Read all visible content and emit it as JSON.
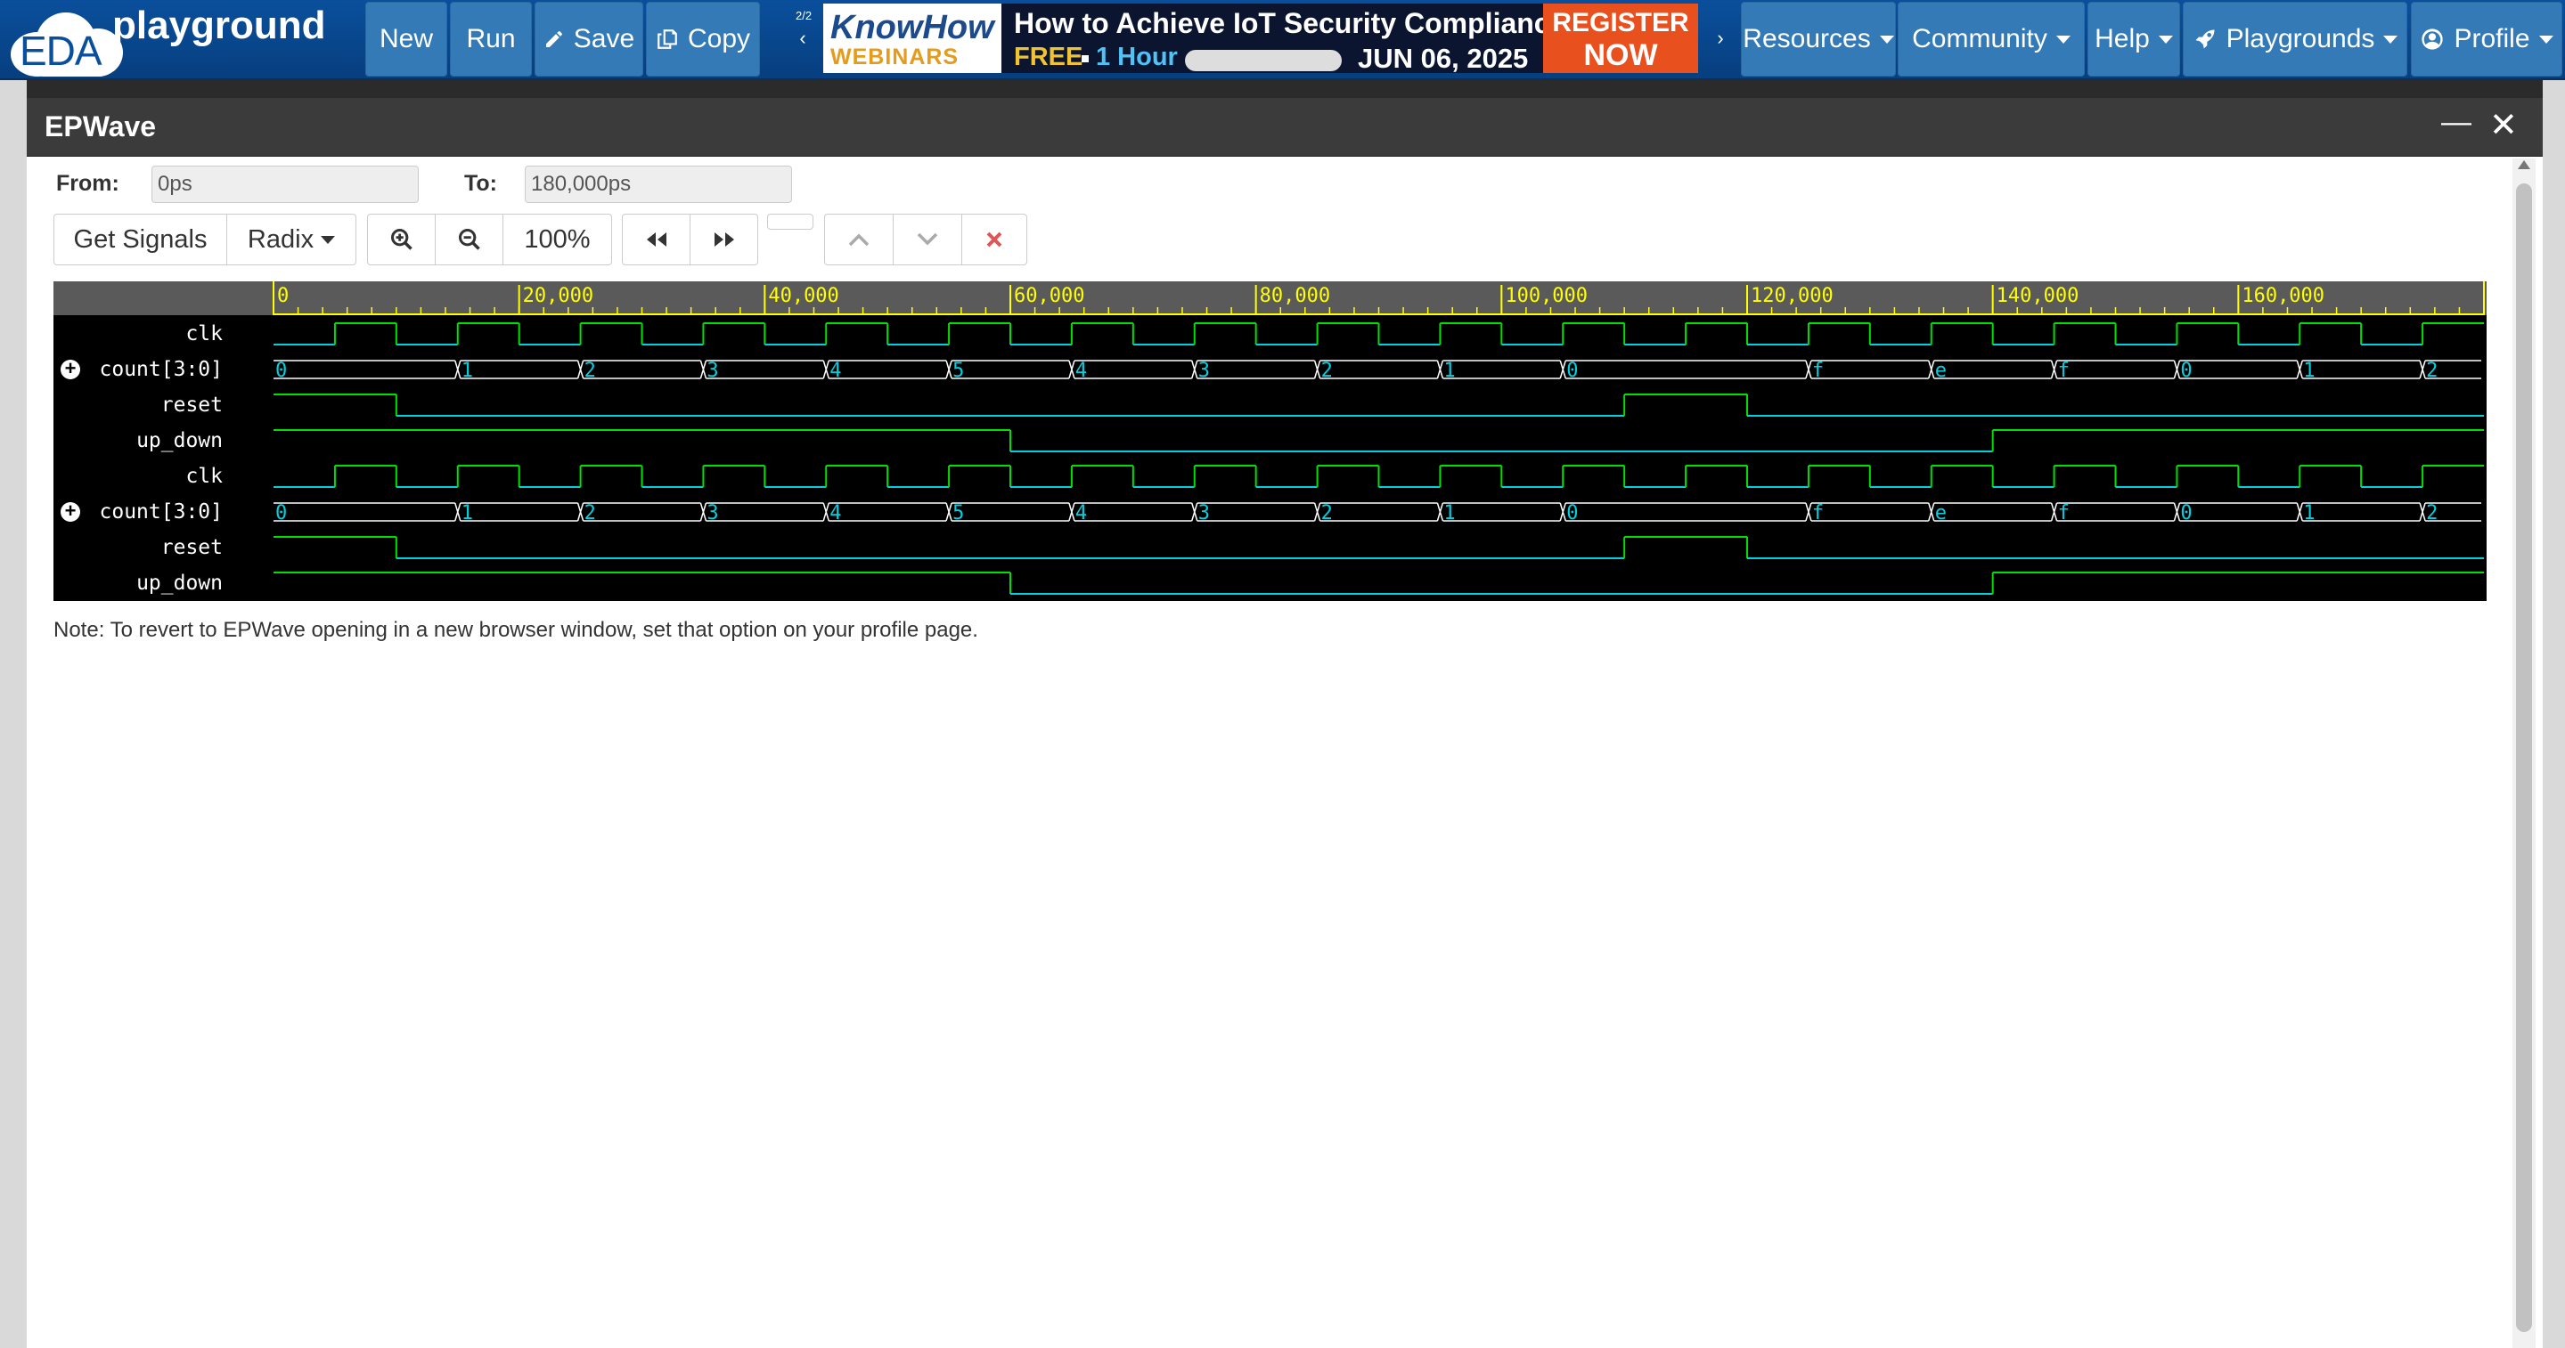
{
  "navbar": {
    "logo_eda": "EDA",
    "logo_playground": "playground",
    "buttons": {
      "new": "New",
      "run": "Run",
      "save": "Save",
      "copy": "Copy"
    },
    "banner_page": "2/2",
    "banner": {
      "brand_top": "KnowHow",
      "brand_bottom": "WEBINARS",
      "title": "How to Achieve IoT Security Compliance",
      "free": "FREE",
      "hour": "1 Hour",
      "date": "JUN 06, 2025",
      "register_line1": "REGISTER",
      "register_line2": "NOW"
    },
    "menus": {
      "resources": "Resources",
      "community": "Community",
      "help": "Help",
      "playgrounds": "Playgrounds",
      "profile": "Profile"
    }
  },
  "epwave": {
    "title": "EPWave",
    "from_label": "From:",
    "from_value": "0ps",
    "to_label": "To:",
    "to_value": "180,000ps",
    "toolbar": {
      "get_signals": "Get Signals",
      "radix": "Radix",
      "zoom_level": "100%"
    },
    "note": "Note: To revert to EPWave opening in a new browser window, set that option on your profile page."
  },
  "waveform": {
    "time_start": 0,
    "time_end": 180000,
    "ticks": [
      0,
      20000,
      40000,
      60000,
      80000,
      100000,
      120000,
      140000,
      160000
    ],
    "tick_labels": [
      "0",
      "20,000",
      "40,000",
      "60,000",
      "80,000",
      "100,000",
      "120,000",
      "140,000",
      "160,000"
    ],
    "clock_half_period": 5000,
    "clock_first_rise": 5000,
    "colors": {
      "signal": "#00d0e0",
      "high": "#00e000",
      "bus": "#ffffff",
      "ruler": "#ffff00",
      "ruler_bg": "#5a5a5a"
    },
    "signals": [
      {
        "name": "clk",
        "type": "clock",
        "expandable": false
      },
      {
        "name": "count[3:0]",
        "type": "bus",
        "expandable": true
      },
      {
        "name": "reset",
        "type": "bit",
        "expandable": false,
        "transitions": [
          [
            0,
            1
          ],
          [
            10000,
            0
          ],
          [
            110000,
            1
          ],
          [
            120000,
            0
          ]
        ]
      },
      {
        "name": "up_down",
        "type": "bit",
        "expandable": false,
        "transitions": [
          [
            0,
            1
          ],
          [
            60000,
            0
          ],
          [
            140000,
            1
          ]
        ]
      },
      {
        "name": "clk",
        "type": "clock",
        "expandable": false
      },
      {
        "name": "count[3:0]",
        "type": "bus",
        "expandable": true
      },
      {
        "name": "reset",
        "type": "bit",
        "expandable": false,
        "transitions": [
          [
            0,
            1
          ],
          [
            10000,
            0
          ],
          [
            110000,
            1
          ],
          [
            120000,
            0
          ]
        ]
      },
      {
        "name": "up_down",
        "type": "bit",
        "expandable": false,
        "transitions": [
          [
            0,
            1
          ],
          [
            60000,
            0
          ],
          [
            140000,
            1
          ]
        ]
      }
    ],
    "bus_values": [
      {
        "t": 0,
        "v": "0"
      },
      {
        "t": 15000,
        "v": "1"
      },
      {
        "t": 25000,
        "v": "2"
      },
      {
        "t": 35000,
        "v": "3"
      },
      {
        "t": 45000,
        "v": "4"
      },
      {
        "t": 55000,
        "v": "5"
      },
      {
        "t": 65000,
        "v": "4"
      },
      {
        "t": 75000,
        "v": "3"
      },
      {
        "t": 85000,
        "v": "2"
      },
      {
        "t": 95000,
        "v": "1"
      },
      {
        "t": 105000,
        "v": "0"
      },
      {
        "t": 125000,
        "v": "f"
      },
      {
        "t": 135000,
        "v": "e"
      },
      {
        "t": 145000,
        "v": "f"
      },
      {
        "t": 155000,
        "v": "0"
      },
      {
        "t": 165000,
        "v": "1"
      },
      {
        "t": 175000,
        "v": "2"
      }
    ]
  }
}
